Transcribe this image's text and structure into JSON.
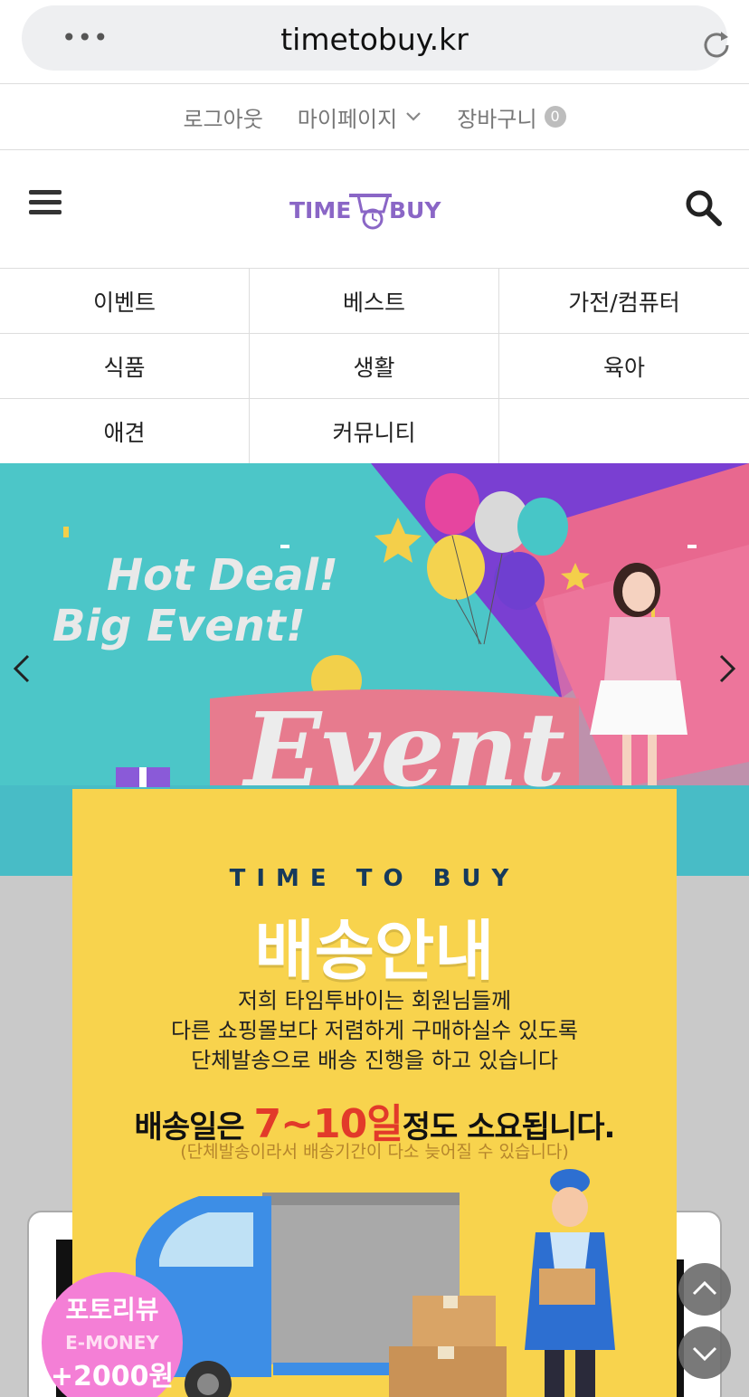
{
  "browser": {
    "url": "timetobuy.kr"
  },
  "util_nav": {
    "logout": "로그아웃",
    "mypage": "마이페이지",
    "cart": "장바구니",
    "cart_count": "0"
  },
  "header": {
    "logo_left": "TIME",
    "logo_right": "BUY",
    "logo_color": "#8a66c6"
  },
  "categories": [
    "이벤트",
    "베스트",
    "가전/컴퓨터",
    "식품",
    "생활",
    "육아",
    "애견",
    "커뮤니티",
    ""
  ],
  "banner": {
    "headline_1": "Hot Deal!",
    "headline_2": "Big Event!",
    "big_word": "Event"
  },
  "popup": {
    "brand": "TIME TO BUY",
    "title": "배송안내",
    "desc_1": "저희 타임투바이는 회원님들께",
    "desc_2": "다른 쇼핑몰보다 저렴하게 구매하실수 있도록",
    "desc_3": "단체발송으로 배송 진행을 하고 있습니다",
    "notice_pre": "배송일은 ",
    "notice_highlight": "7~10일",
    "notice_post": "정도 소요됩니다.",
    "sub_note": "(단체발송이라서 배송기간이 다소 늦어질 수 있습니다)",
    "accent_color": "#e23a2a",
    "bg_color": "#f8d34d"
  },
  "review_badge": {
    "line1": "포토리뷰",
    "line2": "E-MONEY",
    "line3": "+2000원"
  }
}
